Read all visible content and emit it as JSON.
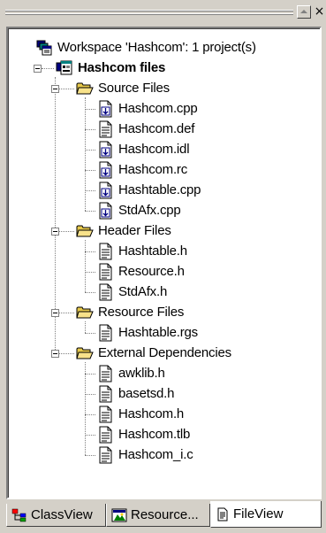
{
  "window": {
    "close_glyph": "×",
    "scroll_up_icon": "triangle-up-icon"
  },
  "tree": {
    "workspace_label": "Workspace 'Hashcom': 1 project(s)",
    "project_label": "Hashcom files",
    "folders": [
      {
        "label": "Source Files",
        "files": [
          {
            "label": "Hashcom.cpp",
            "icon": "source-file-icon"
          },
          {
            "label": "Hashcom.def",
            "icon": "text-file-icon"
          },
          {
            "label": "Hashcom.idl",
            "icon": "source-file-icon"
          },
          {
            "label": "Hashcom.rc",
            "icon": "source-file-icon"
          },
          {
            "label": "Hashtable.cpp",
            "icon": "source-file-icon"
          },
          {
            "label": "StdAfx.cpp",
            "icon": "source-file-icon"
          }
        ]
      },
      {
        "label": "Header Files",
        "files": [
          {
            "label": "Hashtable.h",
            "icon": "text-file-icon"
          },
          {
            "label": "Resource.h",
            "icon": "text-file-icon"
          },
          {
            "label": "StdAfx.h",
            "icon": "text-file-icon"
          }
        ]
      },
      {
        "label": "Resource Files",
        "files": [
          {
            "label": "Hashtable.rgs",
            "icon": "text-file-icon"
          }
        ]
      },
      {
        "label": "External Dependencies",
        "files": [
          {
            "label": "awklib.h",
            "icon": "text-file-icon"
          },
          {
            "label": "basetsd.h",
            "icon": "text-file-icon"
          },
          {
            "label": "Hashcom.h",
            "icon": "text-file-icon"
          },
          {
            "label": "Hashcom.tlb",
            "icon": "text-file-icon"
          },
          {
            "label": "Hashcom_i.c",
            "icon": "text-file-icon"
          }
        ]
      }
    ]
  },
  "tabs": [
    {
      "label": "ClassView",
      "icon": "classview-icon",
      "active": false
    },
    {
      "label": "Resource...",
      "icon": "resourceview-icon",
      "active": false
    },
    {
      "label": "FileView",
      "icon": "fileview-icon",
      "active": true
    }
  ]
}
